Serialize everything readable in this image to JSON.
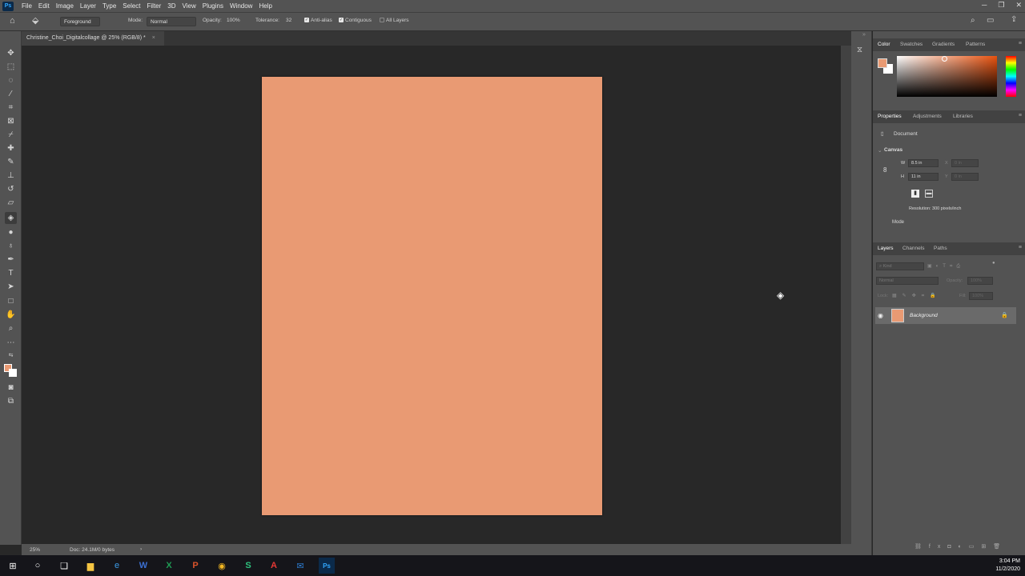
{
  "menubar": {
    "app": "Ps",
    "items": [
      "File",
      "Edit",
      "Image",
      "Layer",
      "Type",
      "Select",
      "Filter",
      "3D",
      "View",
      "Plugins",
      "Window",
      "Help"
    ]
  },
  "options": {
    "preset": "Foreground",
    "mode_label": "Mode:",
    "mode_value": "Normal",
    "opacity_label": "Opacity:",
    "opacity_value": "100%",
    "tolerance_label": "Tolerance:",
    "tolerance_value": "32",
    "antialias": "Anti-alias",
    "contiguous": "Contiguous",
    "all_layers": "All Layers"
  },
  "document": {
    "tab_title": "Christine_Choi_Digitalcollage @ 25% (RGB/8) *",
    "canvas_color": "#e99a73"
  },
  "status": {
    "zoom": "25%",
    "doc": "Doc: 24.1M/0 bytes"
  },
  "color_panel": {
    "tabs": [
      "Color",
      "Swatches",
      "Gradients",
      "Patterns"
    ],
    "foreground": "#e99a73",
    "background": "#ffffff"
  },
  "properties_panel": {
    "tabs": [
      "Properties",
      "Adjustments",
      "Libraries"
    ],
    "kind": "Document",
    "section": "Canvas",
    "w_label": "W",
    "w_value": "8.5 in",
    "h_label": "H",
    "h_value": "11 in",
    "x_label": "X",
    "x_value": "0 in",
    "y_label": "Y",
    "y_value": "0 in",
    "resolution": "Resolution: 300 pixels/inch",
    "mode": "Mode"
  },
  "layers_panel": {
    "tabs": [
      "Layers",
      "Channels",
      "Paths"
    ],
    "search_placeholder": "Kind",
    "blend": "Normal",
    "opacity_label": "Opacity:",
    "opacity_value": "100%",
    "lock_label": "Lock:",
    "fill_label": "Fill:",
    "fill_value": "100%",
    "layers": [
      {
        "name": "Background",
        "visible": true,
        "locked": true
      }
    ]
  },
  "taskbar": {
    "time": "3:04 PM",
    "date": "11/2/2020"
  }
}
